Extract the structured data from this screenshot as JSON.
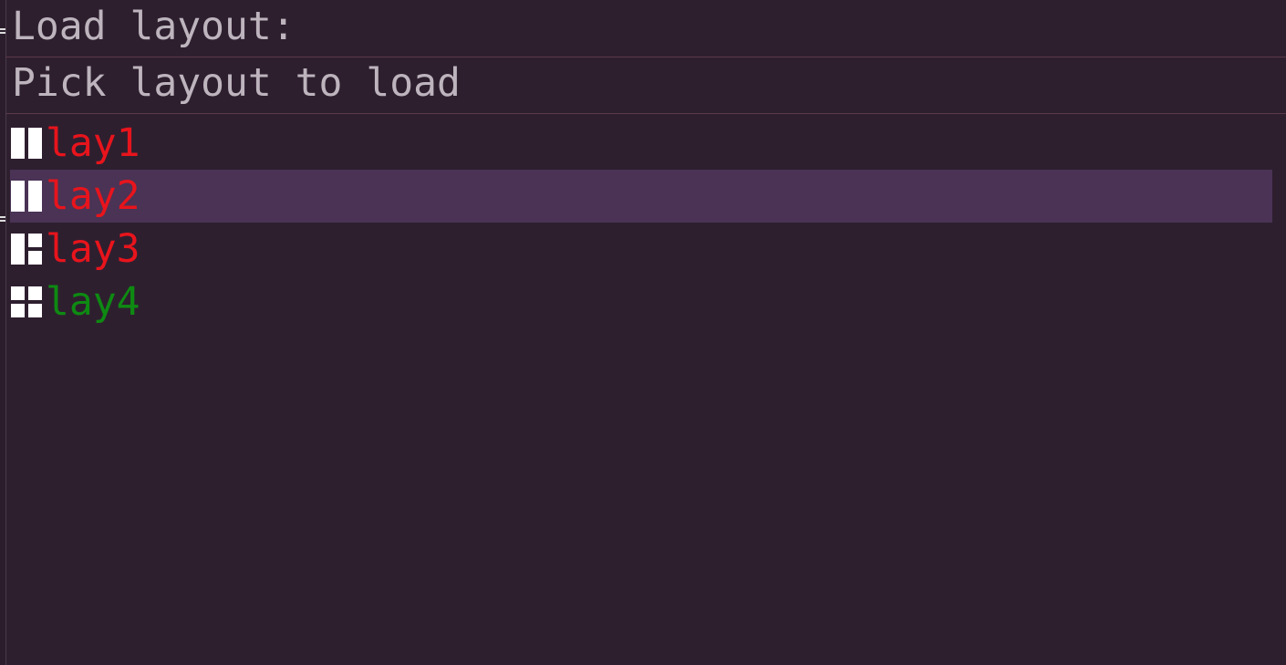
{
  "prompt": {
    "title": "Load layout:",
    "subtitle": "Pick layout to load"
  },
  "layouts": {
    "selected_index": 1,
    "items": [
      {
        "label": "lay1",
        "icon": "two-columns-layout-icon",
        "color": "#e8141c"
      },
      {
        "label": "lay2",
        "icon": "two-columns-layout-icon",
        "color": "#e8141c"
      },
      {
        "label": "lay3",
        "icon": "main-left-stack-right-layout-icon",
        "color": "#e8141c"
      },
      {
        "label": "lay4",
        "icon": "grid-four-layout-icon",
        "color": "#0e8a12"
      }
    ]
  },
  "colors": {
    "background": "#2e1f2f",
    "text": "#bdb4be",
    "selection": "#4a3355",
    "divider": "#5a3a48",
    "inactive_item": "#e8141c",
    "active_item": "#0e8a12"
  }
}
